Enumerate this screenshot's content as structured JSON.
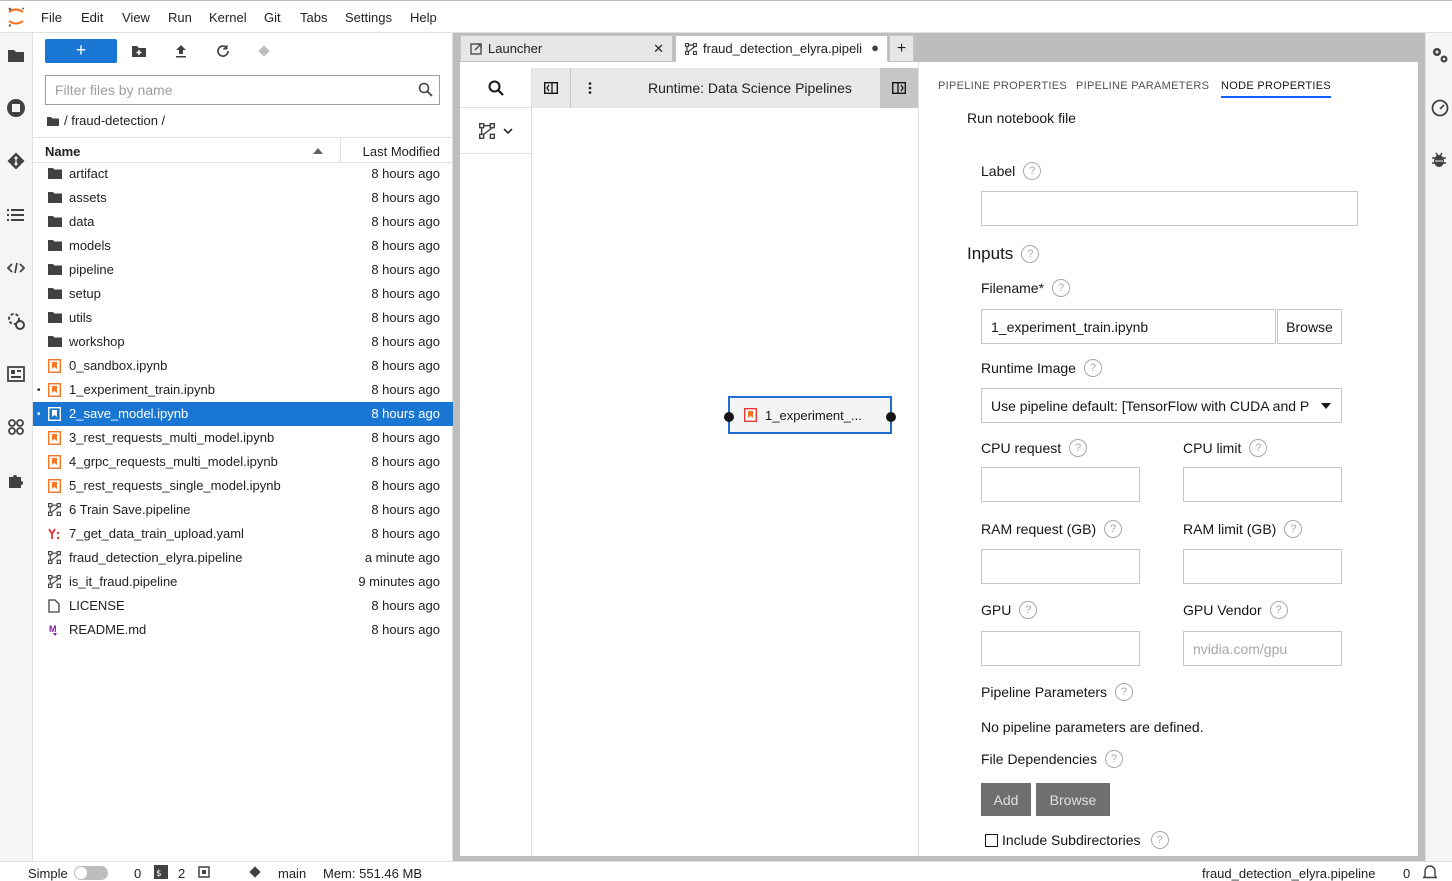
{
  "menubar": {
    "items": [
      "File",
      "Edit",
      "View",
      "Run",
      "Kernel",
      "Git",
      "Tabs",
      "Settings",
      "Help"
    ]
  },
  "colors": {
    "accent": "#1976d2",
    "node_border": "#1f6fd1",
    "notebook_orange": "#f37726",
    "yaml_red": "#e53935",
    "markdown_purple": "#7b1fa2"
  },
  "filebrowser": {
    "new_label": "+",
    "filter_placeholder": "Filter files by name",
    "breadcrumb": "/ fraud-detection /",
    "col_name": "Name",
    "col_modified": "Last Modified",
    "files": [
      {
        "name": "artifact",
        "modified": "8 hours ago",
        "icon": "folder-icon"
      },
      {
        "name": "assets",
        "modified": "8 hours ago",
        "icon": "folder-icon"
      },
      {
        "name": "data",
        "modified": "8 hours ago",
        "icon": "folder-icon"
      },
      {
        "name": "models",
        "modified": "8 hours ago",
        "icon": "folder-icon"
      },
      {
        "name": "pipeline",
        "modified": "8 hours ago",
        "icon": "folder-icon"
      },
      {
        "name": "setup",
        "modified": "8 hours ago",
        "icon": "folder-icon"
      },
      {
        "name": "utils",
        "modified": "8 hours ago",
        "icon": "folder-icon"
      },
      {
        "name": "workshop",
        "modified": "8 hours ago",
        "icon": "folder-icon"
      },
      {
        "name": "0_sandbox.ipynb",
        "modified": "8 hours ago",
        "icon": "notebook-icon"
      },
      {
        "name": "1_experiment_train.ipynb",
        "modified": "8 hours ago",
        "icon": "notebook-icon",
        "running": "•"
      },
      {
        "name": "2_save_model.ipynb",
        "modified": "8 hours ago",
        "icon": "notebook-icon",
        "running": "•",
        "selected": true
      },
      {
        "name": "3_rest_requests_multi_model.ipynb",
        "modified": "8 hours ago",
        "icon": "notebook-icon"
      },
      {
        "name": "4_grpc_requests_multi_model.ipynb",
        "modified": "8 hours ago",
        "icon": "notebook-icon"
      },
      {
        "name": "5_rest_requests_single_model.ipynb",
        "modified": "8 hours ago",
        "icon": "notebook-icon"
      },
      {
        "name": "6 Train Save.pipeline",
        "modified": "8 hours ago",
        "icon": "pipeline-icon"
      },
      {
        "name": "7_get_data_train_upload.yaml",
        "modified": "8 hours ago",
        "icon": "yaml-icon"
      },
      {
        "name": "fraud_detection_elyra.pipeline",
        "modified": "a minute ago",
        "icon": "pipeline-icon"
      },
      {
        "name": "is_it_fraud.pipeline",
        "modified": "9 minutes ago",
        "icon": "pipeline-icon"
      },
      {
        "name": "LICENSE",
        "modified": "8 hours ago",
        "icon": "file-icon"
      },
      {
        "name": "README.md",
        "modified": "8 hours ago",
        "icon": "markdown-icon"
      }
    ]
  },
  "tabs": [
    {
      "label": "Launcher",
      "close": "✕"
    },
    {
      "label": "fraud_detection_elyra.pipeli",
      "close": "●"
    }
  ],
  "add_tab": "+",
  "pipeline": {
    "runtime_label": "Runtime: Data Science Pipelines",
    "node_label": "1_experiment_...",
    "palette_chevron": "⌄"
  },
  "properties": {
    "tabs": [
      "PIPELINE PROPERTIES",
      "PIPELINE PARAMETERS",
      "NODE PROPERTIES"
    ],
    "heading": "Run notebook file",
    "label_field": "Label",
    "inputs_heading": "Inputs",
    "filename_label": "Filename*",
    "filename_value": "1_experiment_train.ipynb",
    "browse_label": "Browse",
    "runtime_image_label": "Runtime Image",
    "runtime_image_value": "Use pipeline default: [TensorFlow with CUDA and P",
    "cpu_request_label": "CPU request",
    "cpu_limit_label": "CPU limit",
    "ram_request_label": "RAM request (GB)",
    "ram_limit_label": "RAM limit (GB)",
    "gpu_label": "GPU",
    "gpu_vendor_label": "GPU Vendor",
    "gpu_vendor_placeholder": "nvidia.com/gpu",
    "pipeline_params_label": "Pipeline Parameters",
    "no_params_text": "No pipeline parameters are defined.",
    "file_deps_label": "File Dependencies",
    "add_label": "Add",
    "browse2_label": "Browse",
    "include_subdirs_label": "Include Subdirectories",
    "help_glyph": "?"
  },
  "statusbar": {
    "mode": "Simple",
    "kernels": "0",
    "terminals": "2",
    "branch": "main",
    "memory": "Mem: 551.46 MB",
    "document": "fraud_detection_elyra.pipeline",
    "notifications": "0"
  }
}
